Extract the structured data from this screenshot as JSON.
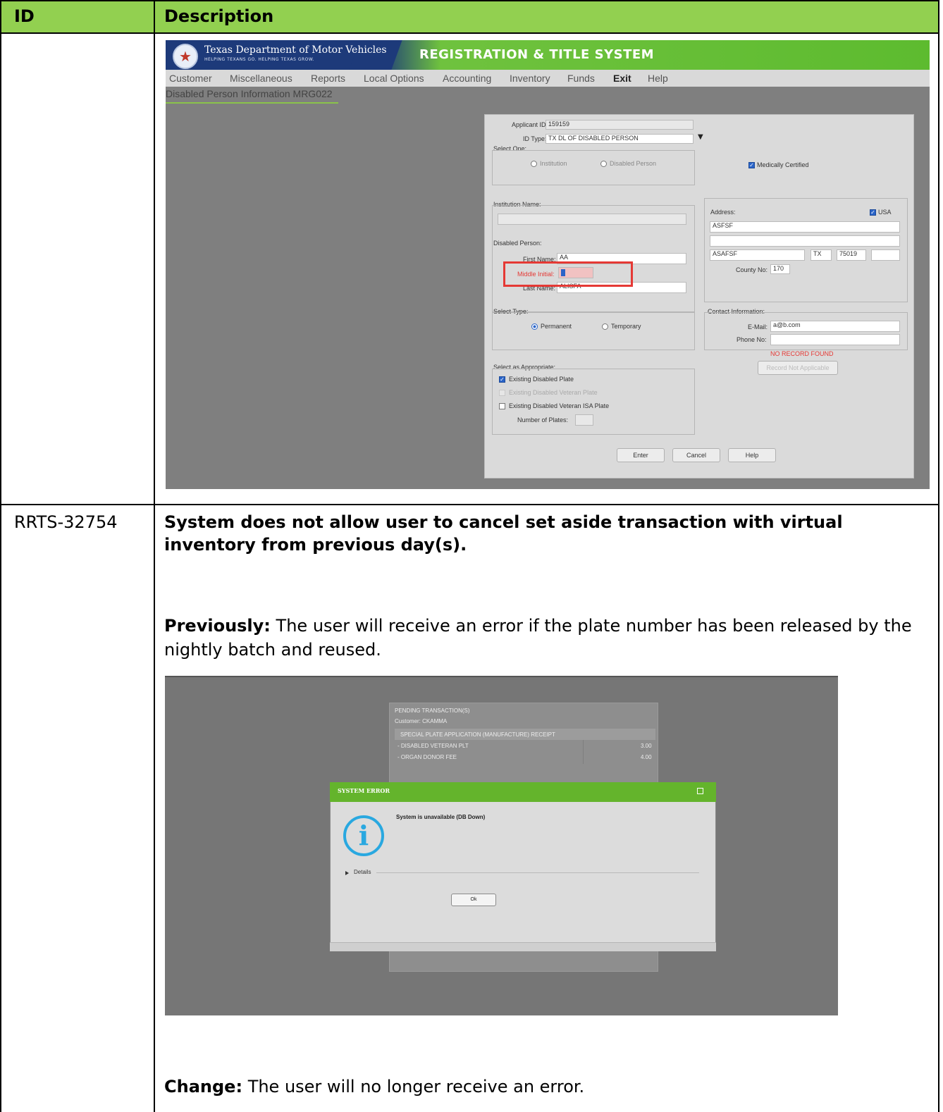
{
  "table": {
    "col_id": "ID",
    "col_description": "Description"
  },
  "screenshot1": {
    "org_name": "Texas Department of Motor Vehicles",
    "org_tagline": "HELPING TEXANS GO. HELPING TEXAS GROW.",
    "system_title": "REGISTRATION & TITLE SYSTEM",
    "menu": [
      "Customer",
      "Miscellaneous",
      "Reports",
      "Local Options",
      "Accounting",
      "Inventory",
      "Funds",
      "Exit",
      "Help"
    ],
    "page_title": "Disabled Person Information MRG022",
    "applicant_id_label": "Applicant ID:",
    "applicant_id_value": "159159",
    "id_type_label": "ID Type:",
    "id_type_value": "TX DL OF DISABLED PERSON",
    "select_one_label": "Select One:",
    "institution_option": "Institution",
    "disabled_person_option": "Disabled Person",
    "medically_certified": "Medically Certified",
    "institution_name_label": "Institution Name:",
    "address_label": "Address:",
    "usa_label": "USA",
    "address_line1": "ASFSF",
    "city": "ASAFSF",
    "state": "TX",
    "zip": "75019",
    "county_label": "County No:",
    "county_value": "170",
    "disabled_person_label": "Disabled Person:",
    "first_name_label": "First Name:",
    "first_name_value": "AA",
    "middle_initial_label": "Middle Initial:",
    "last_name_label": "Last Name:",
    "last_name_value": "ALISFA",
    "select_type_label": "Select Type:",
    "permanent_label": "Permanent",
    "temporary_label": "Temporary",
    "contact_info_label": "Contact Information:",
    "email_label": "E-Mail:",
    "email_value": "a@b.com",
    "phone_label": "Phone No:",
    "no_record": "NO RECORD FOUND",
    "record_btn": "Record Not Applicable",
    "select_appropriate_label": "Select as Appropriate:",
    "existing_disabled_plate": "Existing Disabled Plate",
    "existing_dv_plate": "Existing Disabled Veteran Plate",
    "existing_dv_isa_plate": "Existing Disabled Veteran ISA Plate",
    "number_of_plates_label": "Number of Plates:",
    "enter_btn": "Enter",
    "cancel_btn": "Cancel",
    "help_btn": "Help"
  },
  "row2": {
    "id": "RRTS-32754",
    "title": "System does not allow user to cancel set aside transaction with virtual inventory from previous day(s).",
    "previously_label": "Previously:",
    "previously_text": "The user will receive an error if the plate number has been released by the nightly batch and reused.",
    "change_label": "Change:",
    "change_text": "The user will no longer receive an error."
  },
  "screenshot2": {
    "pending_title": "PENDING TRANSACTION(S)",
    "customer_line": "Customer:  CKAMMA",
    "receipt_header": "SPECIAL PLATE APPLICATION (MANUFACTURE) RECEIPT",
    "items": [
      {
        "label": "- DISABLED VETERAN PLT",
        "amount": "3.00"
      },
      {
        "label": "- ORGAN DONOR FEE",
        "amount": "4.00"
      }
    ],
    "dialog_title": "SYSTEM ERROR",
    "dialog_message": "System is unavailable (DB Down)",
    "details_label": "Details",
    "ok_label": "Ok"
  }
}
